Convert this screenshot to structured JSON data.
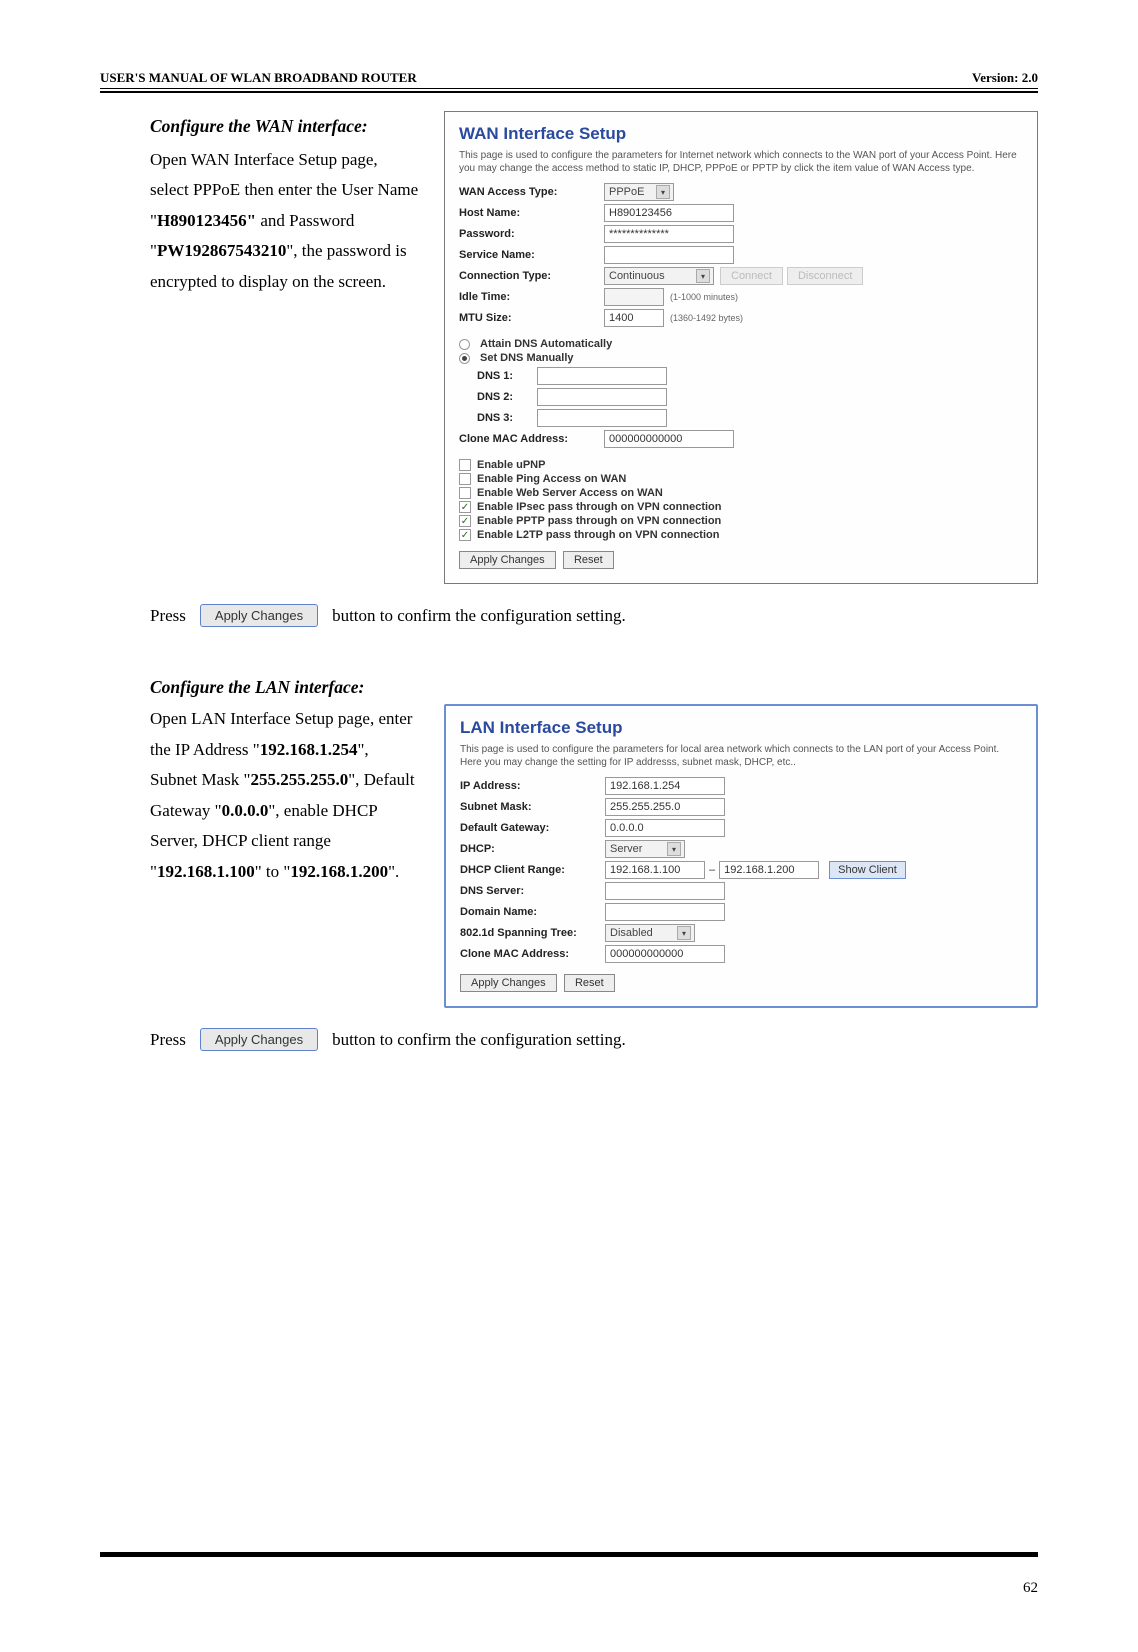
{
  "header": {
    "left": "USER'S MANUAL OF WLAN BROADBAND ROUTER",
    "right": "Version: 2.0"
  },
  "wan_section": {
    "heading": "Configure the WAN interface:",
    "body_parts": {
      "p1_a": "Open WAN Interface Setup page, select PPPoE then enter the User Name \"",
      "p1_user": "H890123456\"",
      "p1_b": " and Password \"",
      "p1_pass": "PW192867543210",
      "p1_c": "\", the password is encrypted to display on the screen."
    },
    "panel": {
      "title": "WAN Interface Setup",
      "desc": "This page is used to configure the parameters for Internet network which connects to the WAN port of your Access Point. Here you may change the access method to static IP, DHCP, PPPoE or PPTP by click the item value of WAN Access type.",
      "labels": {
        "access_type": "WAN Access Type:",
        "host_name": "Host Name:",
        "password": "Password:",
        "service_name": "Service Name:",
        "conn_type": "Connection Type:",
        "idle_time": "Idle Time:",
        "mtu_size": "MTU Size:",
        "attain_dns": "Attain DNS Automatically",
        "set_dns": "Set DNS Manually",
        "dns1": "DNS 1:",
        "dns2": "DNS 2:",
        "dns3": "DNS 3:",
        "clone_mac": "Clone MAC Address:",
        "en_upnp": "Enable uPNP",
        "en_ping": "Enable Ping Access on WAN",
        "en_web": "Enable Web Server Access on WAN",
        "en_ipsec": "Enable IPsec pass through on VPN connection",
        "en_pptp": "Enable PPTP pass through on VPN connection",
        "en_l2tp": "Enable L2TP pass through on VPN connection"
      },
      "values": {
        "access_type": "PPPoE",
        "host_name": "H890123456",
        "password": "**************",
        "conn_type": "Continuous",
        "idle_time": "",
        "idle_hint": "(1-1000 minutes)",
        "mtu_size": "1400",
        "mtu_hint": "(1360-1492 bytes)",
        "clone_mac": "000000000000"
      },
      "buttons": {
        "connect": "Connect",
        "disconnect": "Disconnect",
        "apply": "Apply Changes",
        "reset": "Reset"
      }
    },
    "press_line": {
      "press": "Press",
      "btn": "Apply Changes",
      "after": "button to confirm the configuration setting."
    }
  },
  "lan_section": {
    "heading": "Configure the LAN interface:",
    "body_parts": {
      "a": "Open LAN Interface Setup page, enter the IP Address \"",
      "ip": "192.168.1.254",
      "b": "\", Subnet Mask \"",
      "mask": "255.255.255.0",
      "c": "\", Default Gateway \"",
      "gw": "0.0.0.0",
      "d": "\", enable DHCP Server, DHCP client range \"",
      "r1": "192.168.1.100",
      "e": "\" to \"",
      "r2": "192.168.1.200",
      "f": "\"."
    },
    "panel": {
      "title": "LAN Interface Setup",
      "desc": "This page is used to configure the parameters for local area network which connects to the LAN port of your Access Point. Here you may change the setting for IP addresss, subnet mask, DHCP, etc..",
      "labels": {
        "ip": "IP Address:",
        "mask": "Subnet Mask:",
        "gw": "Default Gateway:",
        "dhcp": "DHCP:",
        "range": "DHCP Client Range:",
        "dns": "DNS Server:",
        "domain": "Domain Name:",
        "stp": "802.1d Spanning Tree:",
        "clone": "Clone MAC Address:"
      },
      "values": {
        "ip": "192.168.1.254",
        "mask": "255.255.255.0",
        "gw": "0.0.0.0",
        "dhcp": "Server",
        "range_from": "192.168.1.100",
        "range_to": "192.168.1.200",
        "stp": "Disabled",
        "clone": "000000000000"
      },
      "buttons": {
        "show": "Show Client",
        "apply": "Apply Changes",
        "reset": "Reset"
      }
    },
    "press_line": {
      "press": "Press",
      "btn": "Apply Changes",
      "after": "button to confirm the configuration setting."
    }
  },
  "page_number": "62"
}
